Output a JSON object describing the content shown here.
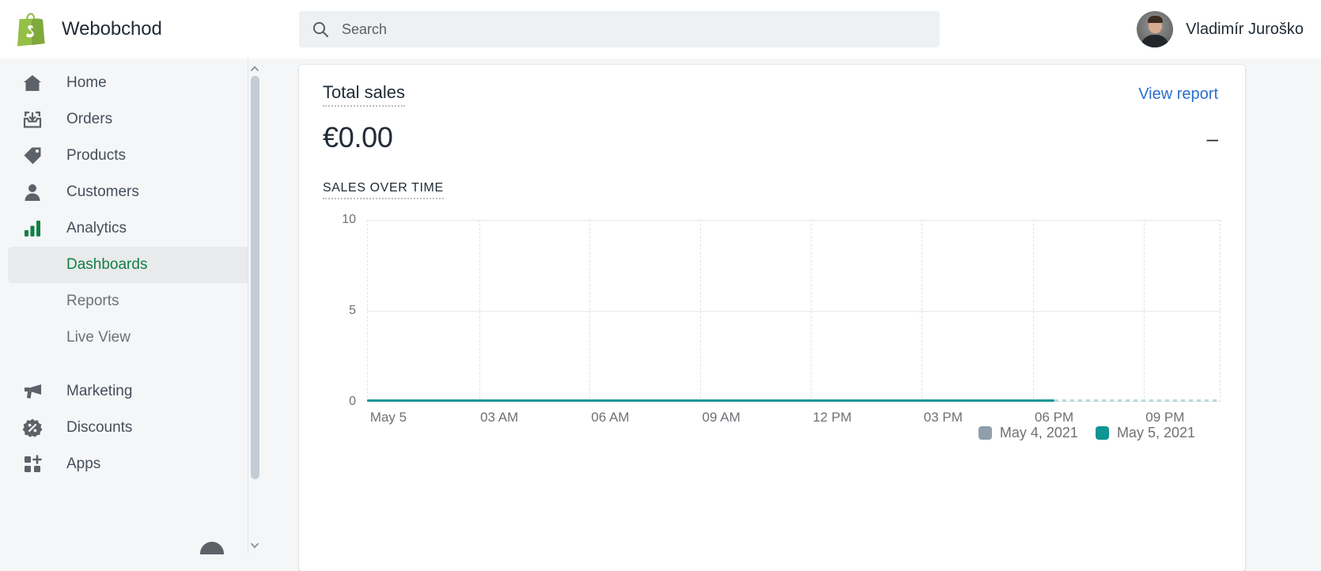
{
  "topbar": {
    "logo_icon": "shopify-bag-icon",
    "store_name": "Webobchod",
    "search": {
      "icon": "search-icon",
      "placeholder": "Search",
      "value": ""
    },
    "user": {
      "name": "Vladimír Juroško",
      "avatar_icon": "user-avatar-photo"
    }
  },
  "sidebar": {
    "items": [
      {
        "label": "Home",
        "icon": "home-icon"
      },
      {
        "label": "Orders",
        "icon": "orders-inbox-icon"
      },
      {
        "label": "Products",
        "icon": "tag-icon"
      },
      {
        "label": "Customers",
        "icon": "person-icon"
      },
      {
        "label": "Analytics",
        "icon": "bar-chart-icon"
      }
    ],
    "sub_items": [
      {
        "label": "Dashboards",
        "active": true
      },
      {
        "label": "Reports",
        "active": false
      },
      {
        "label": "Live View",
        "active": false
      }
    ],
    "items_lower": [
      {
        "label": "Marketing",
        "icon": "megaphone-icon"
      },
      {
        "label": "Discounts",
        "icon": "discount-percent-icon"
      },
      {
        "label": "Apps",
        "icon": "apps-grid-plus-icon"
      }
    ],
    "scrollbar": {
      "up_icon": "chevron-up-icon",
      "down_icon": "chevron-down-icon"
    },
    "help_icon": "help-bubble-icon"
  },
  "card": {
    "metric_title": "Total sales",
    "metric_value": "€0.00",
    "view_report_label": "View report",
    "comparison_value": "–",
    "chart_label": "SALES OVER TIME"
  },
  "colors": {
    "accent_green": "#108043",
    "link_blue": "#2c6ecb",
    "series_current": "#0e9594",
    "series_previous": "#919eab",
    "shopify_green": "#95bf47"
  },
  "chart_data": {
    "type": "line",
    "title": "SALES OVER TIME",
    "xlabel": "",
    "ylabel": "",
    "ylim": [
      0,
      10
    ],
    "y_ticks": [
      0,
      5,
      10
    ],
    "x_ticks": [
      "May 5",
      "03 AM",
      "06 AM",
      "09 AM",
      "12 PM",
      "03 PM",
      "06 PM",
      "09 PM"
    ],
    "grid": true,
    "legend_position": "bottom-right",
    "series": [
      {
        "name": "May 4, 2021",
        "color": "#919eab",
        "style": "solid",
        "values": [
          0,
          0,
          0,
          0,
          0,
          0,
          0,
          0
        ]
      },
      {
        "name": "May 5, 2021",
        "color": "#0e9594",
        "style": "solid-then-dashed",
        "values": [
          0,
          0,
          0,
          0,
          0,
          0,
          0,
          0
        ]
      }
    ],
    "notes": "Both series flat at 0 across the full 24-hour range; May 5 line is dashed after ~08 PM (no data yet)."
  }
}
